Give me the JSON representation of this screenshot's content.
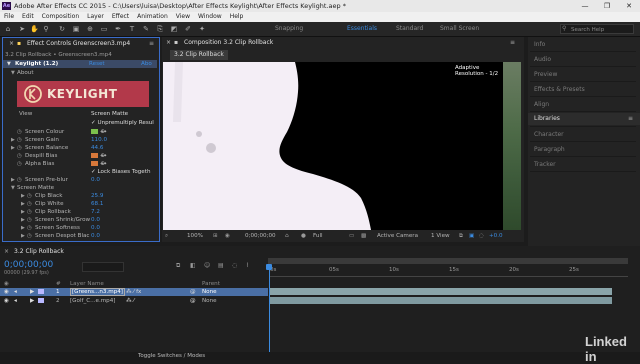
{
  "title_bar": {
    "title": "Adobe After Effects CC 2015 - C:\\Users\\luisa\\Desktop\\After Effects Keylight\\After Effects Keylight.aep *",
    "app_icon": "Ae"
  },
  "menu": [
    "File",
    "Edit",
    "Composition",
    "Layer",
    "Effect",
    "Animation",
    "View",
    "Window",
    "Help"
  ],
  "toolbar": {
    "snapping": "Snapping",
    "workspaces": [
      "Essentials",
      "Standard",
      "Small Screen"
    ],
    "active_workspace": "Essentials",
    "search_placeholder": "Search Help"
  },
  "effect_controls": {
    "tab": "Effect Controls  Greenscreen3.mp4",
    "breadcrumb": "3.2 Clip Rollback • Greenscreen3.mp4",
    "effect_name": "Keylight (1.2)",
    "reset": "Reset",
    "abo": "Abo",
    "about": "About",
    "logo_text": "KEYLIGHT",
    "view_label": "View",
    "view_value": "Screen Matte",
    "unpremultiply": "Unpremultiply Resul",
    "props": [
      {
        "label": "Screen Colour",
        "value": "",
        "swatch": "#7cc04c"
      },
      {
        "label": "Screen Gain",
        "value": "110.0"
      },
      {
        "label": "Screen Balance",
        "value": "44.6"
      },
      {
        "label": "Despill Bias",
        "value": "",
        "swatch": "#d7783a"
      },
      {
        "label": "Alpha Bias",
        "value": "",
        "swatch": "#d7783a"
      }
    ],
    "lock_biases": "Lock Biases Togeth",
    "screen_preblur": "Screen Pre-blur",
    "screen_preblur_value": "0.0",
    "screen_matte": "Screen Matte",
    "matte_props": [
      {
        "label": "Clip Black",
        "value": "25.9"
      },
      {
        "label": "Clip White",
        "value": "68.1"
      },
      {
        "label": "Clip Rollback",
        "value": "7.2"
      },
      {
        "label": "Screen Shrink/Grow",
        "value": "0.0"
      },
      {
        "label": "Screen Softness",
        "value": "0.0"
      },
      {
        "label": "Screen Despot Blac",
        "value": "0.0"
      }
    ]
  },
  "composition": {
    "tab": "Composition 3.2 Clip Rollback",
    "subtab": "3.2 Clip Rollback",
    "overlay": "Adaptive Resolution - 1/2",
    "footer": {
      "zoom": "100%",
      "timecode": "0;00;00;00",
      "resolution": "Full",
      "camera": "Active Camera",
      "view": "1 View",
      "offset": "+0.0"
    }
  },
  "right_panels": [
    "Info",
    "Audio",
    "Preview",
    "Effects & Presets",
    "Align",
    "Libraries",
    "Character",
    "Paragraph",
    "Tracker"
  ],
  "active_right_panel": "Libraries",
  "timeline": {
    "tab": "3.2 Clip Rollback",
    "timecode": "0;00;00;00",
    "fps": "00000 (29.97 fps)",
    "header": {
      "num": "#",
      "layer": "Layer Name",
      "parent": "Parent"
    },
    "layers": [
      {
        "num": "1",
        "name": "[Greens...n3.mp4]",
        "parent": "None",
        "selected": true
      },
      {
        "num": "2",
        "name": "[Golf_C...e.mp4]",
        "parent": "None",
        "selected": false
      }
    ],
    "ruler": [
      "0s",
      "05s",
      "10s",
      "15s",
      "20s",
      "25s"
    ],
    "footer": "Toggle Switches / Modes"
  },
  "watermark": "Linked in",
  "colors": {
    "accent": "#3b8be0",
    "effect_header": "#b2394a",
    "selected_layer": "#4a6fa5"
  }
}
